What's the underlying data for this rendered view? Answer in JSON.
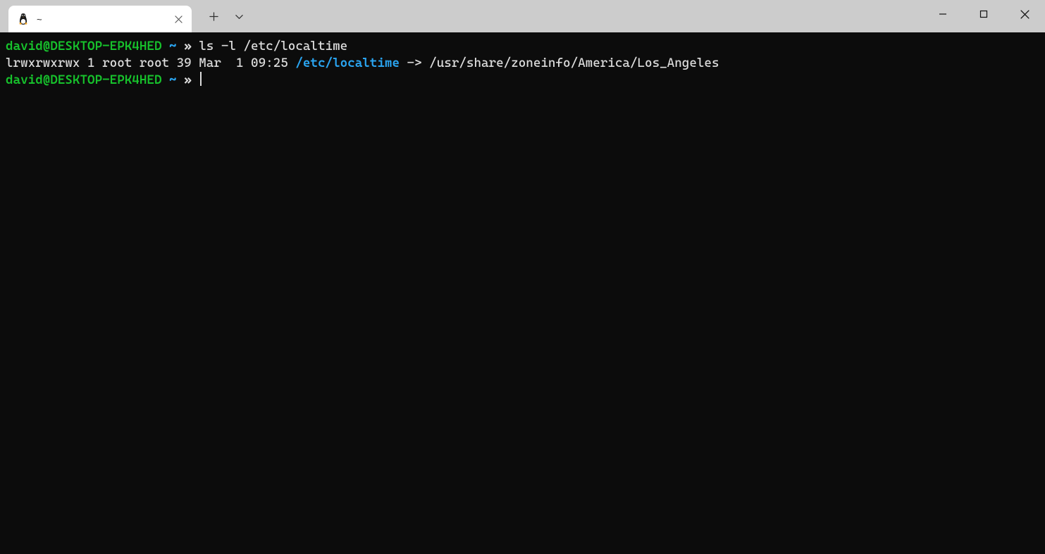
{
  "window": {
    "tab": {
      "title": "~"
    }
  },
  "terminal": {
    "lines": [
      {
        "segments": [
          {
            "text": "david@DESKTOP-EPK4HED",
            "cls": "green"
          },
          {
            "text": " ",
            "cls": "white"
          },
          {
            "text": "~",
            "cls": "cyan"
          },
          {
            "text": " ",
            "cls": "white"
          },
          {
            "text": "»",
            "cls": "white bold"
          },
          {
            "text": " ",
            "cls": "white"
          },
          {
            "text": "ls -l /etc/localtime",
            "cls": "white"
          }
        ],
        "cursor": false
      },
      {
        "segments": [
          {
            "text": "lrwxrwxrwx 1 root root 39 Mar  1 09:25 ",
            "cls": "white"
          },
          {
            "text": "/etc/localtime",
            "cls": "cyan"
          },
          {
            "text": " -> /usr/share/zoneinfo/America/Los_Angeles",
            "cls": "white"
          }
        ],
        "cursor": false
      },
      {
        "segments": [
          {
            "text": "david@DESKTOP-EPK4HED",
            "cls": "green"
          },
          {
            "text": " ",
            "cls": "white"
          },
          {
            "text": "~",
            "cls": "cyan"
          },
          {
            "text": " ",
            "cls": "white"
          },
          {
            "text": "»",
            "cls": "white bold"
          },
          {
            "text": " ",
            "cls": "white"
          }
        ],
        "cursor": true
      }
    ]
  }
}
